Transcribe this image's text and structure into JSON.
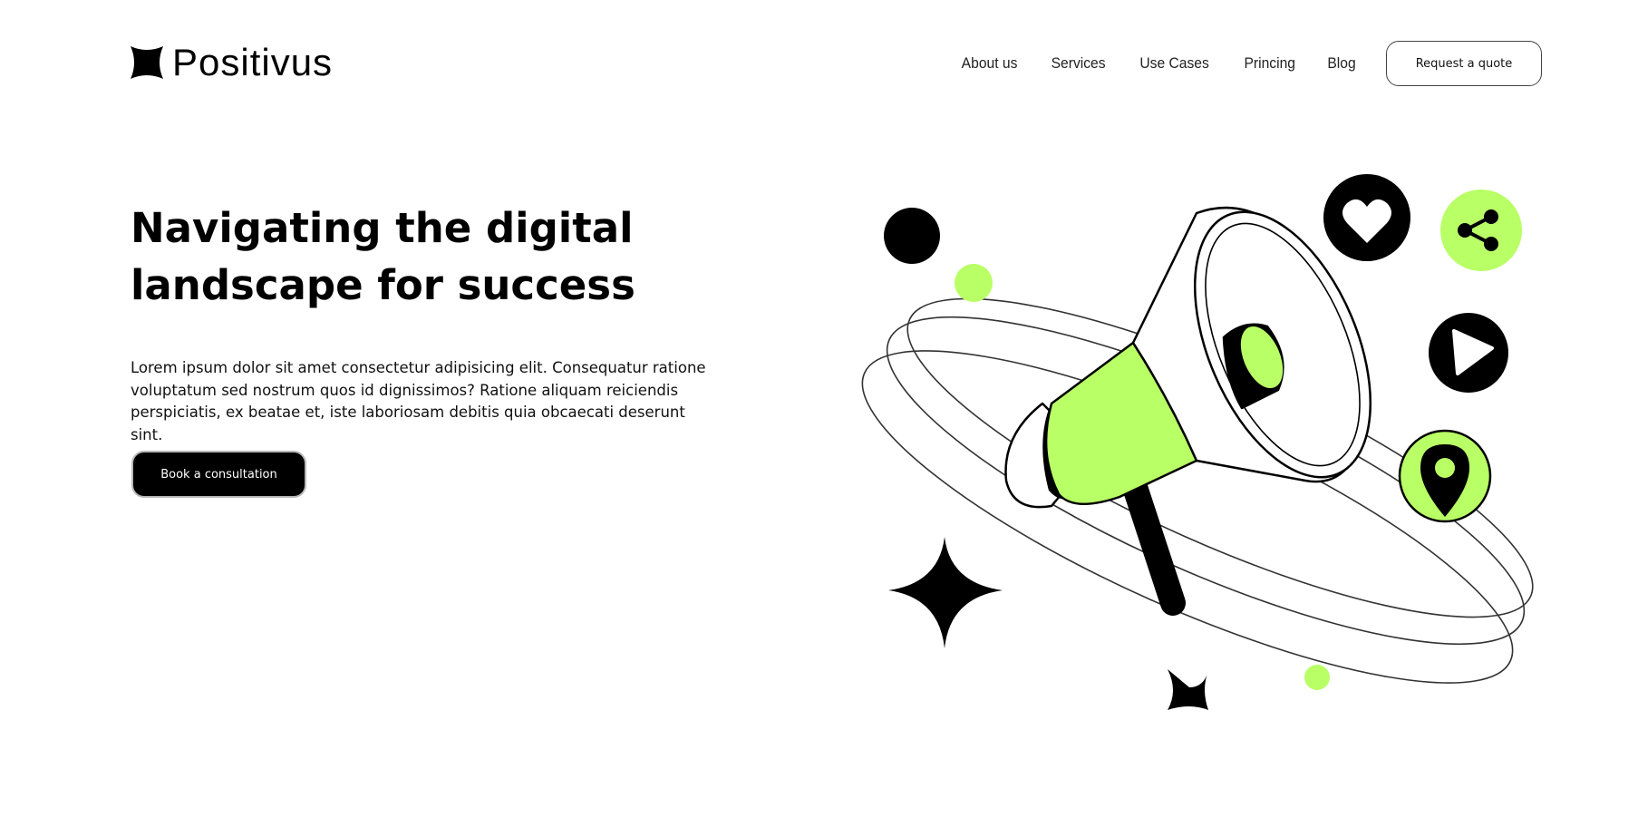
{
  "brand": {
    "name": "Positivus",
    "icon": "four-point-star-icon"
  },
  "nav": {
    "links": [
      "About us",
      "Services",
      "Use Cases",
      "Princing",
      "Blog"
    ],
    "quote_button": "Request a quote"
  },
  "hero": {
    "title": "Navigating the digital landscape for success",
    "description": "Lorem ipsum dolor sit amet consectetur adipisicing elit. Consequatur ratione voluptatum sed nostrum quos id dignissimos? Ratione aliquam reiciendis perspiciatis, ex beatae et, iste laboriosam debitis quia obcaecati deserunt sint.",
    "cta_button": "Book a consultation"
  },
  "illustration": {
    "subject": "megaphone",
    "icons": [
      "heart-icon",
      "share-icon",
      "play-icon",
      "location-pin-icon"
    ]
  },
  "colors": {
    "accent": "#B9FF66",
    "dark": "#000000",
    "background": "#FFFFFF"
  }
}
